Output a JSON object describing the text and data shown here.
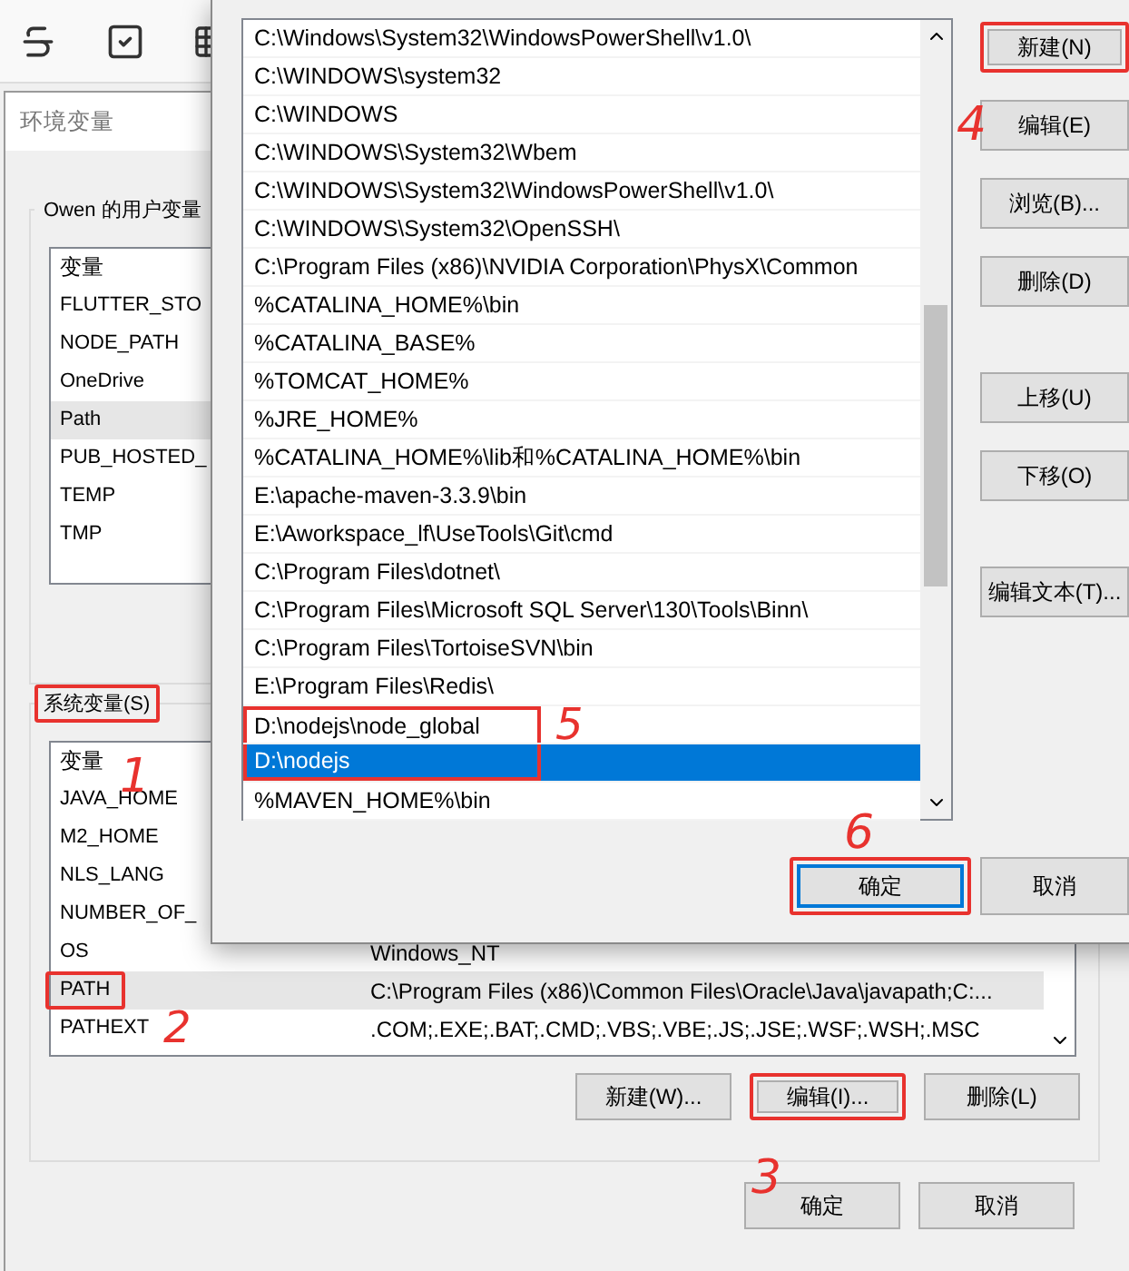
{
  "env_window": {
    "title": "环境变量",
    "user_group": {
      "label": "Owen 的用户变量",
      "header": "变量",
      "rows": [
        {
          "name": "FLUTTER_STO",
          "selected": false
        },
        {
          "name": "NODE_PATH",
          "selected": false
        },
        {
          "name": "OneDrive",
          "selected": false
        },
        {
          "name": "Path",
          "selected": true
        },
        {
          "name": "PUB_HOSTED_",
          "selected": false
        },
        {
          "name": "TEMP",
          "selected": false
        },
        {
          "name": "TMP",
          "selected": false
        }
      ]
    },
    "system_group": {
      "label": "系统变量(S)",
      "highlighted": true,
      "header": "变量",
      "rows": [
        {
          "name": "JAVA_HOME",
          "selected": false,
          "highlighted": false
        },
        {
          "name": "M2_HOME",
          "selected": false,
          "highlighted": false
        },
        {
          "name": "NLS_LANG",
          "selected": false,
          "highlighted": false
        },
        {
          "name": "NUMBER_OF_",
          "selected": false,
          "highlighted": false
        },
        {
          "name": "OS",
          "value": "Windows_NT",
          "selected": false,
          "highlighted": false
        },
        {
          "name": "PATH",
          "value": "C:\\Program Files (x86)\\Common Files\\Oracle\\Java\\javapath;C:...",
          "selected": true,
          "highlighted": true
        },
        {
          "name": "PATHEXT",
          "value": ".COM;.EXE;.BAT;.CMD;.VBS;.VBE;.JS;.JSE;.WSF;.WSH;.MSC",
          "selected": false,
          "highlighted": false,
          "annotation": "2"
        }
      ],
      "buttons": [
        {
          "label": "新建(W)...",
          "highlighted": false
        },
        {
          "label": "编辑(I)...",
          "highlighted": true
        },
        {
          "label": "删除(L)",
          "highlighted": false
        }
      ]
    },
    "footer_buttons": [
      {
        "label": "确定"
      },
      {
        "label": "取消"
      }
    ]
  },
  "edit_dialog": {
    "entries": [
      {
        "text": "C:\\Windows\\System32\\WindowsPowerShell\\v1.0\\",
        "selected": false,
        "highlighted": false
      },
      {
        "text": "C:\\WINDOWS\\system32",
        "selected": false,
        "highlighted": false
      },
      {
        "text": "C:\\WINDOWS",
        "selected": false,
        "highlighted": false
      },
      {
        "text": "C:\\WINDOWS\\System32\\Wbem",
        "selected": false,
        "highlighted": false
      },
      {
        "text": "C:\\WINDOWS\\System32\\WindowsPowerShell\\v1.0\\",
        "selected": false,
        "highlighted": false
      },
      {
        "text": "C:\\WINDOWS\\System32\\OpenSSH\\",
        "selected": false,
        "highlighted": false
      },
      {
        "text": "C:\\Program Files (x86)\\NVIDIA Corporation\\PhysX\\Common",
        "selected": false,
        "highlighted": false
      },
      {
        "text": "%CATALINA_HOME%\\bin",
        "selected": false,
        "highlighted": false
      },
      {
        "text": "%CATALINA_BASE%",
        "selected": false,
        "highlighted": false
      },
      {
        "text": "%TOMCAT_HOME%",
        "selected": false,
        "highlighted": false
      },
      {
        "text": "%JRE_HOME%",
        "selected": false,
        "highlighted": false
      },
      {
        "text": "%CATALINA_HOME%\\lib和%CATALINA_HOME%\\bin",
        "selected": false,
        "highlighted": false
      },
      {
        "text": "E:\\apache-maven-3.3.9\\bin",
        "selected": false,
        "highlighted": false
      },
      {
        "text": "E:\\Aworkspace_lf\\UseTools\\Git\\cmd",
        "selected": false,
        "highlighted": false
      },
      {
        "text": "C:\\Program Files\\dotnet\\",
        "selected": false,
        "highlighted": false
      },
      {
        "text": "C:\\Program Files\\Microsoft SQL Server\\130\\Tools\\Binn\\",
        "selected": false,
        "highlighted": false
      },
      {
        "text": "C:\\Program Files\\TortoiseSVN\\bin",
        "selected": false,
        "highlighted": false
      },
      {
        "text": "E:\\Program Files\\Redis\\",
        "selected": false,
        "highlighted": false
      },
      {
        "text": "D:\\nodejs\\node_global",
        "selected": false,
        "highlighted": true,
        "annotation": "5"
      },
      {
        "text": "D:\\nodejs",
        "selected": true,
        "highlighted": true
      },
      {
        "text": "%MAVEN_HOME%\\bin",
        "selected": false,
        "highlighted": false
      }
    ],
    "side_buttons": [
      [
        {
          "label": "新建(N)",
          "highlighted": true
        },
        {
          "label": "编辑(E)",
          "highlighted": false
        },
        {
          "label": "浏览(B)...",
          "highlighted": false
        },
        {
          "label": "删除(D)",
          "highlighted": false
        }
      ],
      [
        {
          "label": "上移(U)",
          "highlighted": false
        },
        {
          "label": "下移(O)",
          "highlighted": false
        }
      ],
      [
        {
          "label": "编辑文本(T)...",
          "highlighted": false
        }
      ]
    ],
    "footer_buttons": [
      {
        "label": "确定",
        "default": true,
        "highlighted": true
      },
      {
        "label": "取消",
        "default": false,
        "highlighted": false
      }
    ]
  },
  "annotations": [
    "1",
    "3",
    "4",
    "6"
  ]
}
